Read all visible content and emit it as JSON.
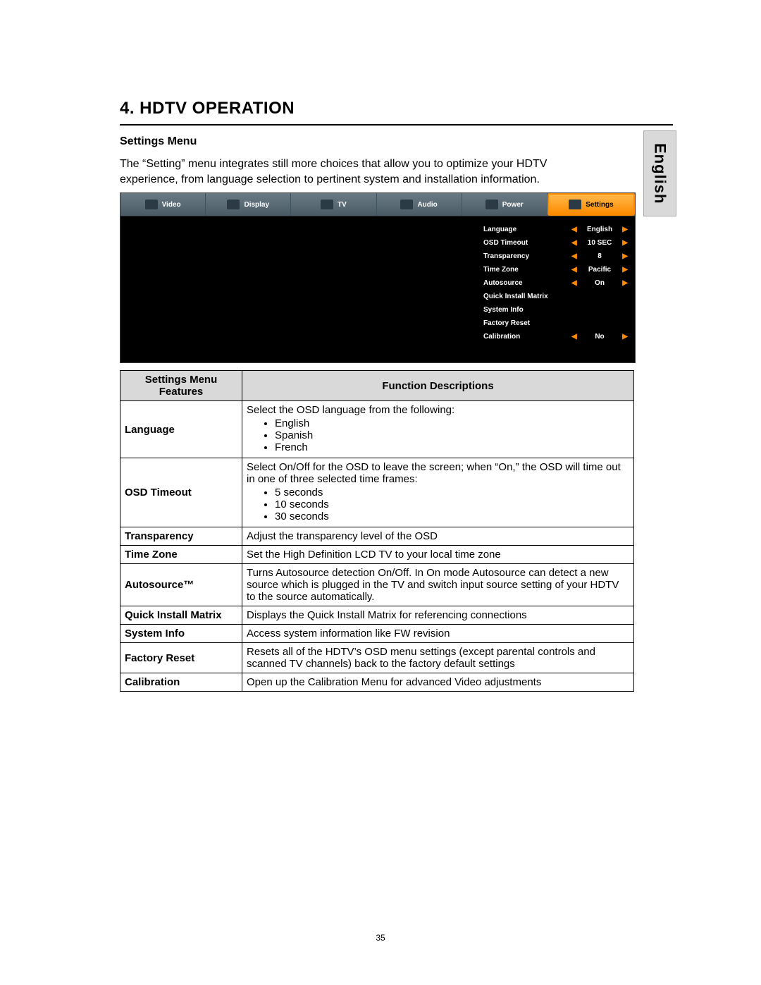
{
  "lang_tab": "English",
  "section_title": "4.    HDTV OPERATION",
  "subheading": "Settings Menu",
  "intro": "The “Setting” menu integrates still more choices that allow you to optimize your HDTV experience, from language selection to pertinent system and installation information.",
  "page_number": "35",
  "osd": {
    "tabs": [
      "Video",
      "Display",
      "TV",
      "Audio",
      "Power",
      "Settings"
    ],
    "active_tab": "Settings",
    "rows": [
      {
        "label": "Language",
        "value": "English",
        "arrows": true
      },
      {
        "label": "OSD Timeout",
        "value": "10 SEC",
        "arrows": true
      },
      {
        "label": "Transparency",
        "value": "8",
        "arrows": true
      },
      {
        "label": "Time Zone",
        "value": "Pacific",
        "arrows": true
      },
      {
        "label": "Autosource",
        "value": "On",
        "arrows": true
      },
      {
        "label": "Quick Install Matrix",
        "value": "",
        "arrows": false
      },
      {
        "label": "System Info",
        "value": "",
        "arrows": false
      },
      {
        "label": "Factory Reset",
        "value": "",
        "arrows": false
      },
      {
        "label": "Calibration",
        "value": "No",
        "arrows": true
      }
    ]
  },
  "table": {
    "head_feature": "Settings Menu Features",
    "head_desc": "Function Descriptions",
    "rows": [
      {
        "feature": "Language",
        "desc_pre": "Select the OSD language from the following:",
        "bullets": [
          "English",
          "Spanish",
          "French"
        ]
      },
      {
        "feature": "OSD Timeout",
        "desc_pre": "Select On/Off for the OSD to leave the screen; when “On,” the OSD will time out in one of three selected time frames:",
        "bullets": [
          "5 seconds",
          "10 seconds",
          "30 seconds"
        ]
      },
      {
        "feature": "Transparency",
        "desc_pre": "Adjust the transparency level of the OSD"
      },
      {
        "feature": "Time Zone",
        "desc_pre": "Set the High Definition LCD TV to your local time zone"
      },
      {
        "feature": "Autosource™",
        "desc_pre": "Turns Autosource detection On/Off.   In On mode Autosource can detect a new source which is plugged in the  TV and switch input source setting of your HDTV to the source automatically."
      },
      {
        "feature": "Quick Install Matrix",
        "desc_pre": "Displays the Quick Install Matrix for referencing connections"
      },
      {
        "feature": "System Info",
        "desc_pre": "Access system information like FW revision"
      },
      {
        "feature": "Factory Reset",
        "desc_pre": "Resets all of the HDTV’s OSD menu settings (except parental controls and scanned TV channels) back to the factory default settings"
      },
      {
        "feature": "Calibration",
        "desc_pre": "Open up the Calibration  Menu for advanced Video adjustments"
      }
    ]
  }
}
